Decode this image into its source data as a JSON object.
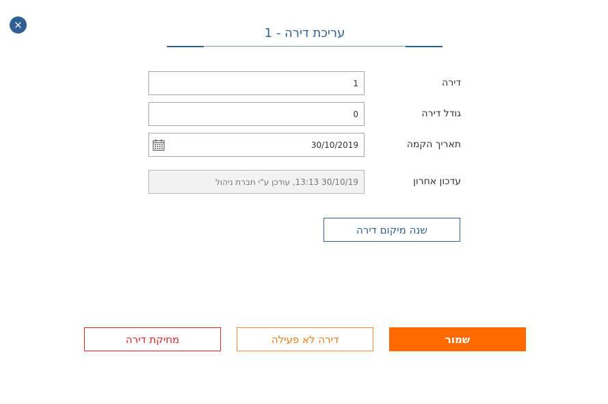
{
  "dialog": {
    "title": "עריכת דירה - 1"
  },
  "form": {
    "apartment_label": "דירה",
    "apartment_value": "1",
    "size_label": "גודל דירה",
    "size_value": "0",
    "build_date_label": "תאריך הקמה",
    "build_date_value": "30/10/2019",
    "last_update_label": "עדכון אחרון",
    "last_update_value": "30/10/19 13:13, עודכן ע\"י חברת ניהול"
  },
  "buttons": {
    "change_location": "שנה מיקום דירה",
    "save": "שמור",
    "inactive": "דירה לא פעילה",
    "delete": "מחיקת דירה"
  },
  "icons": {
    "close": "close-icon",
    "calendar": "calendar-icon"
  },
  "colors": {
    "primary_blue": "#2f5f92",
    "accent_orange": "#ff6a00",
    "danger_red": "#e02424"
  }
}
